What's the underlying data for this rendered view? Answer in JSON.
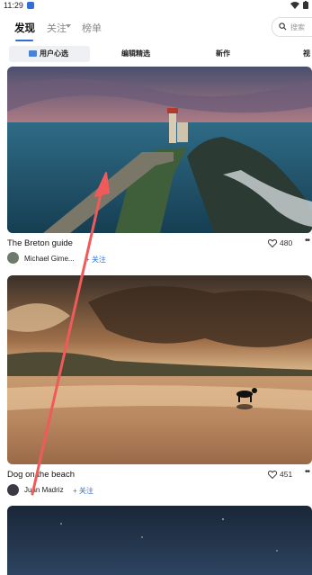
{
  "status_bar": {
    "time": "11:29"
  },
  "nav": {
    "tabs": [
      {
        "label": "发现",
        "active": true
      },
      {
        "label": "关注",
        "active": false
      },
      {
        "label": "榜单",
        "active": false
      }
    ],
    "search_placeholder": "搜索"
  },
  "sub_tabs": [
    "用户心选",
    "编辑精选",
    "新作",
    "视"
  ],
  "cards": [
    {
      "title": "The Breton guide",
      "likes": "480",
      "author": "Michael Gime...",
      "follow_label": "+ 关注"
    },
    {
      "title": "Dog on the beach",
      "likes": "451",
      "author": "Juan Madriz",
      "follow_label": "+ 关注"
    }
  ],
  "colors": {
    "accent": "#2f6fd6",
    "annotation_arrow": "#f05a5a"
  },
  "icons": [
    "notification-icon",
    "wifi-icon",
    "battery-icon",
    "chevron-down-icon",
    "search-icon",
    "heart-icon",
    "more-icon"
  ]
}
